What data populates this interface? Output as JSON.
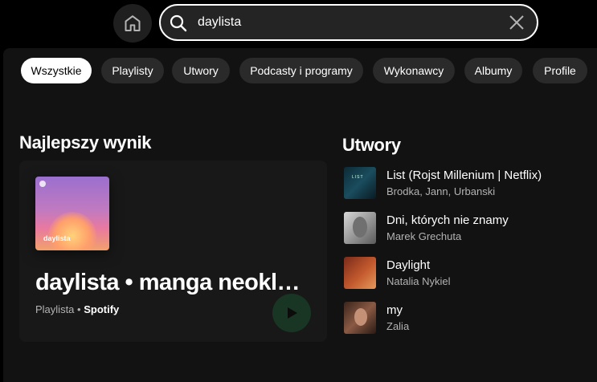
{
  "search": {
    "query": "daylista"
  },
  "filters": [
    {
      "label": "Wszystkie",
      "active": true
    },
    {
      "label": "Playlisty",
      "active": false
    },
    {
      "label": "Utwory",
      "active": false
    },
    {
      "label": "Podcasty i programy",
      "active": false
    },
    {
      "label": "Wykonawcy",
      "active": false
    },
    {
      "label": "Albumy",
      "active": false
    },
    {
      "label": "Profile",
      "active": false
    }
  ],
  "top_result": {
    "heading": "Najlepszy wynik",
    "cover_label": "daylista",
    "title": "daylista • manga neoklasyczny środa rano",
    "type": "Playlista",
    "separator": "•",
    "owner": "Spotify"
  },
  "tracks": {
    "heading": "Utwory",
    "items": [
      {
        "title": "List (Rojst Millenium | Netflix)",
        "artist": "Brodka, Jann, Urbanski"
      },
      {
        "title": "Dni, których nie znamy",
        "artist": "Marek Grechuta"
      },
      {
        "title": "Daylight",
        "artist": "Natalia Nykiel"
      },
      {
        "title": "my",
        "artist": "Zalia"
      }
    ]
  },
  "colors": {
    "background": "#000000",
    "surface": "#121212",
    "card": "#181818",
    "chip": "#2a2a2a",
    "text_secondary": "#b3b3b3",
    "accent": "#1db954"
  }
}
